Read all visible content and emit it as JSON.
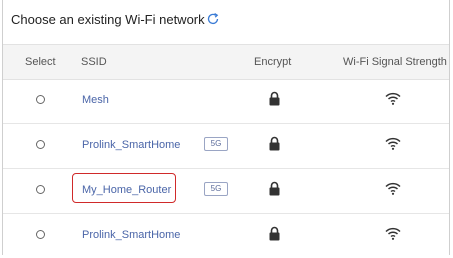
{
  "title": "Choose an existing Wi-Fi network",
  "columns": {
    "select": "Select",
    "ssid": "SSID",
    "encrypt": "Encrypt",
    "signal": "Wi-Fi Signal Strength"
  },
  "networks": [
    {
      "ssid": "Mesh",
      "band": "",
      "encrypted": true,
      "selected": false,
      "highlighted": false,
      "icons": {
        "lock": "lock-icon",
        "signal": "wifi-signal-icon"
      }
    },
    {
      "ssid": "Prolink_SmartHome",
      "band": "5G",
      "encrypted": true,
      "selected": false,
      "highlighted": false,
      "icons": {
        "lock": "lock-icon",
        "signal": "wifi-signal-icon"
      }
    },
    {
      "ssid": "My_Home_Router",
      "band": "5G",
      "encrypted": true,
      "selected": false,
      "highlighted": true,
      "icons": {
        "lock": "lock-icon",
        "signal": "wifi-signal-icon"
      }
    },
    {
      "ssid": "Prolink_SmartHome",
      "band": "",
      "encrypted": true,
      "selected": false,
      "highlighted": false,
      "icons": {
        "lock": "lock-icon",
        "signal": "wifi-signal-icon"
      }
    }
  ],
  "icons": {
    "refresh": "refresh-icon"
  },
  "colors": {
    "ssid_text": "#4a65a8",
    "highlight_border": "#d02a2a",
    "header_bg": "#f4f4f4",
    "icon": "#333333"
  }
}
